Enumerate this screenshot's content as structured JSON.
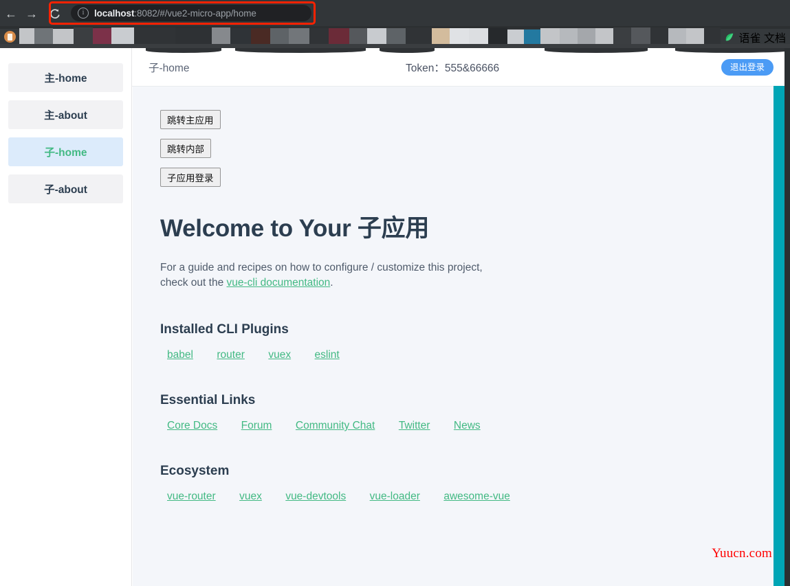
{
  "browser": {
    "back_icon": "back-arrow-icon",
    "forward_icon": "forward-arrow-icon",
    "reload_icon": "reload-icon",
    "info_icon": "info-circle-icon",
    "url_host": "localhost",
    "url_rest": ":8082/#/vue2-micro-app/home",
    "highlight_color": "#ff2200",
    "bookmark_yuque_label": "语雀 文档",
    "bookmark_leaf_icon": "leaf-icon",
    "bookmark_doc_icon": "document-icon"
  },
  "sidebar": {
    "items": [
      {
        "label": "主-home",
        "active": false
      },
      {
        "label": "主-about",
        "active": false
      },
      {
        "label": "子-home",
        "active": true
      },
      {
        "label": "子-about",
        "active": false
      }
    ]
  },
  "header": {
    "title": "子-home",
    "token_label": "Token：",
    "token_value": "555&66666",
    "logout_label": "退出登录",
    "logout_color": "#4b9bf5"
  },
  "content": {
    "buttons": [
      {
        "label": "跳转主应用"
      },
      {
        "label": "跳转内部"
      },
      {
        "label": "子应用登录"
      }
    ],
    "welcome_heading": "Welcome to Your 子应用",
    "intro_prefix": "For a guide and recipes on how to configure / customize this project, check out the ",
    "intro_link": "vue-cli documentation",
    "intro_suffix": ".",
    "sections": [
      {
        "heading": "Installed CLI Plugins",
        "links": [
          "babel",
          "router",
          "vuex",
          "eslint"
        ]
      },
      {
        "heading": "Essential Links",
        "links": [
          "Core Docs",
          "Forum",
          "Community Chat",
          "Twitter",
          "News"
        ]
      },
      {
        "heading": "Ecosystem",
        "links": [
          "vue-router",
          "vuex",
          "vue-devtools",
          "vue-loader",
          "awesome-vue"
        ]
      }
    ],
    "accent_green": "#42b983",
    "heading_color": "#2c3e50",
    "background": "#f4f6fa"
  },
  "watermark": {
    "text": "Yuucn.com",
    "color": "#ff0000"
  },
  "scrollbar": {
    "thumb_color": "#00a5b5"
  }
}
